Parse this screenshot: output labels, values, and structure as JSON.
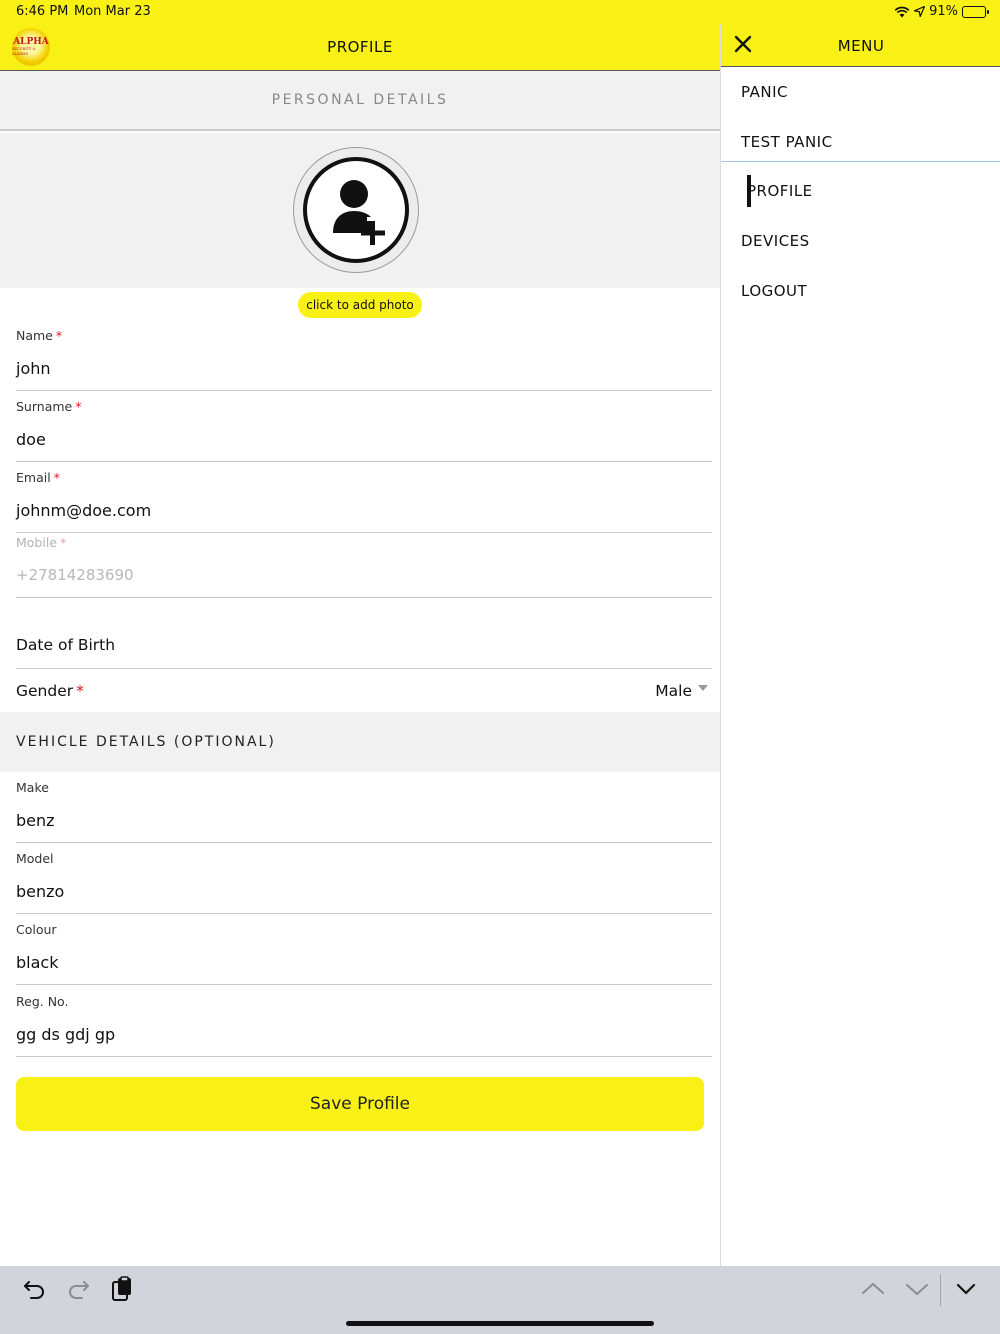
{
  "status_bar": {
    "time": "6:46 PM",
    "date": "Mon Mar 23",
    "battery": "91%",
    "battery_level": 0.91
  },
  "app_bar": {
    "logo_text": "ALPHA",
    "logo_subtext": "SECURITY & ALARMS",
    "title": "PROFILE"
  },
  "personal_section": {
    "title": "PERSONAL DETAILS",
    "photo_button": "click to add photo"
  },
  "fields": {
    "name": {
      "label": "Name",
      "required": "*",
      "value": "john"
    },
    "surname": {
      "label": "Surname",
      "required": "*",
      "value": "doe"
    },
    "email": {
      "label": "Email",
      "required": "*",
      "value": "johnm@doe.com"
    },
    "mobile": {
      "label": "Mobile",
      "required": "*",
      "value": "+27814283690"
    },
    "dob": {
      "label": "Date of Birth"
    },
    "gender": {
      "label": "Gender",
      "required": "*",
      "value": "Male"
    }
  },
  "vehicle_section": {
    "title": "VEHICLE DETAILS (OPTIONAL)"
  },
  "vehicle": {
    "make": {
      "label": "Make",
      "value": "benz"
    },
    "model": {
      "label": "Model",
      "value": "benzo"
    },
    "colour": {
      "label": "Colour",
      "value": "black"
    },
    "reg": {
      "label": "Reg. No.",
      "value": "gg ds gdj gp"
    }
  },
  "save_button": "Save Profile",
  "menu": {
    "title": "MENU",
    "items": [
      {
        "label": "PANIC"
      },
      {
        "label": "TEST PANIC"
      },
      {
        "label": "PROFILE",
        "active": true
      },
      {
        "label": "DEVICES"
      },
      {
        "label": "LOGOUT"
      }
    ]
  },
  "colors": {
    "accent": "#f9f116",
    "required": "#e1151b",
    "section_bg": "#f1f1f1",
    "battery": "#2ec13c"
  },
  "keyboard_toolbar": {
    "icons": [
      "undo-icon",
      "redo-icon",
      "paste-icon",
      "chevron-up-icon",
      "chevron-down-icon",
      "dismiss-keyboard-icon"
    ]
  }
}
